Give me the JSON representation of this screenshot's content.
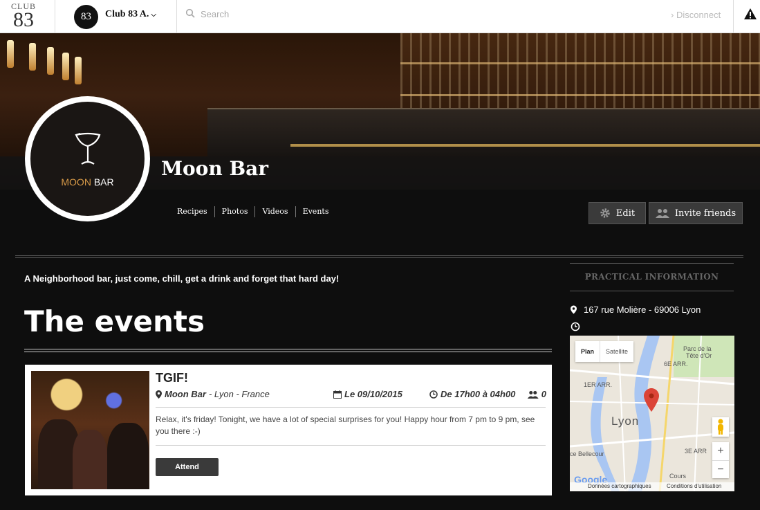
{
  "topbar": {
    "logo_line1": "CLUB",
    "logo_line2": "83",
    "club_avatar_text": "83",
    "club_name": "Club 83 A.",
    "search_placeholder": "Search",
    "disconnect_label": "› Disconnect",
    "icons": {
      "search": "search-icon",
      "warning": "warning-icon",
      "chevron": "chevron-down-icon"
    }
  },
  "profile": {
    "venue_name": "Moon Bar",
    "brand_part1": "MOON",
    "brand_part2": " BAR"
  },
  "subnav": {
    "items": [
      "Recipes",
      "Photos",
      "Videos",
      "Events"
    ]
  },
  "actions": {
    "edit_label": "Edit",
    "invite_label": "Invite friends"
  },
  "main": {
    "tagline": "A Neighborhood bar, just come, chill, get a drink and forget that hard day!",
    "events_heading": "The events"
  },
  "event": {
    "title": "TGIF!",
    "venue": "Moon Bar",
    "location": " - Lyon - France",
    "date": "Le 09/10/2015",
    "time": "De 17h00 à 04h00",
    "attendees": "0",
    "description": "Relax, it's friday! Tonight, we have a lot of special surprises for you! Happy hour from 7 pm to 9 pm, see you there :-)",
    "attend_label": "Attend"
  },
  "sidebar": {
    "title": "PRACTICAL INFORMATION",
    "address": "167 rue Molière - 69006 Lyon",
    "map": {
      "tab_plan": "Plan",
      "tab_satellite": "Satellite",
      "city": "Lyon",
      "labels": {
        "parc": "Parc de la",
        "tete": "Tête d'Or",
        "arr6": "6E ARR.",
        "arr1": "1ER ARR.",
        "arr3": "3E ARR",
        "bellecour": "ce Bellecour",
        "cours": "Cours"
      },
      "zoom_in": "+",
      "zoom_out": "−",
      "google": "Google",
      "footer_data": "Données cartographiques",
      "footer_terms": "Conditions d'utilisation"
    }
  },
  "colors": {
    "accent_gold": "#d89a48",
    "button_dark": "#3a3a3a",
    "map_pin": "#db4437"
  }
}
